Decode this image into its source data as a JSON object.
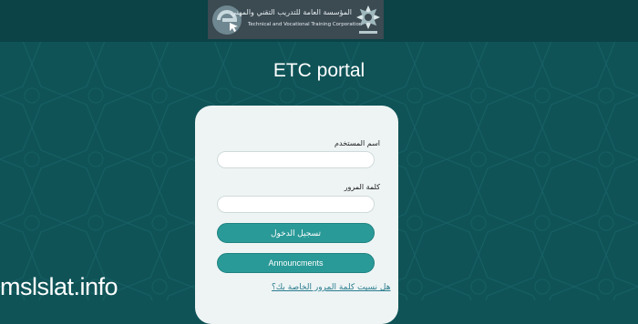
{
  "logo": {
    "org_ar": "المؤسسة العامة للتدريب التقني والمهني",
    "org_en": "Technical and Vocational Training Corporation"
  },
  "page": {
    "title": "ETC portal"
  },
  "login": {
    "username_label": "اسم المستخدم",
    "username_value": "",
    "password_label": "كلمة المرور",
    "password_value": "",
    "login_button": "تسجيل الدخول",
    "announcements_button": "Announcments",
    "forgot_link": "هل نسيت كلمة المرور الخاصة بك؟"
  },
  "watermark": "mslslat.info",
  "colors": {
    "background": "#0f5357",
    "accent": "#2a9a98",
    "card": "#eef4f4"
  }
}
